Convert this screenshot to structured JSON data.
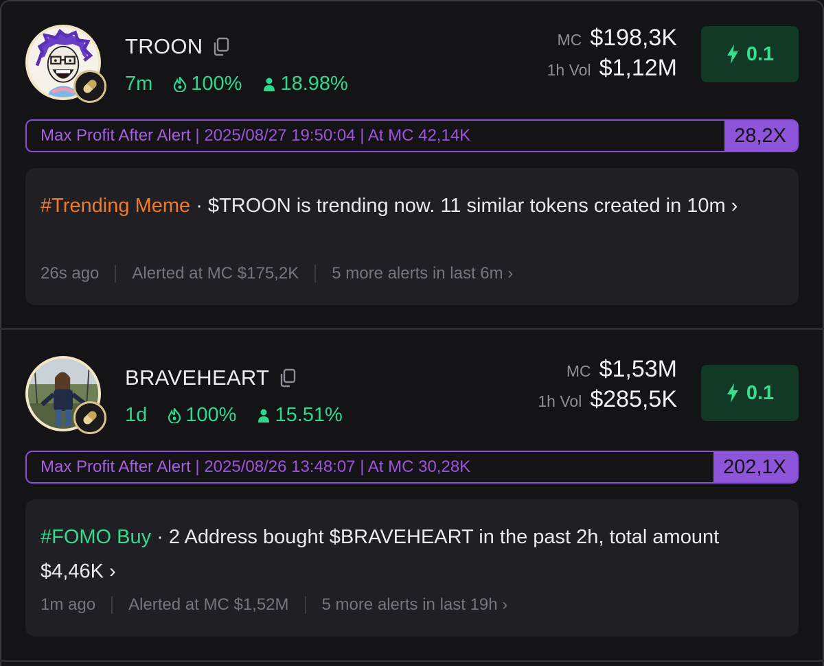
{
  "colors": {
    "background": "#141416",
    "accent_green": "#35e08f",
    "accent_purple": "#8e55db",
    "tag_orange": "#ef7a2a"
  },
  "cards": [
    {
      "name": "TROON",
      "age": "7m",
      "fire_pct": "100%",
      "holders_pct": "18.98%",
      "mc_label": "MC",
      "mc_value": "$198,3K",
      "vol_label": "1h Vol",
      "vol_value": "$1,12M",
      "buy_amount": "0.1",
      "profit_label": "Max Profit After Alert",
      "profit_info": "| 2025/08/27 19:50:04 | At MC 42,14K",
      "profit_mult": "28,2X",
      "tag": "#Trending Meme",
      "message": " · $TROON is trending now. 11 similar tokens created in 10m ›",
      "time_ago": "26s ago",
      "alerted_at": "Alerted at MC $175,2K",
      "more_alerts": "5 more alerts in last 6m ›"
    },
    {
      "name": "BRAVEHEART",
      "age": "1d",
      "fire_pct": "100%",
      "holders_pct": "15.51%",
      "mc_label": "MC",
      "mc_value": "$1,53M",
      "vol_label": "1h Vol",
      "vol_value": "$285,5K",
      "buy_amount": "0.1",
      "profit_label": "Max Profit After Alert",
      "profit_info": "| 2025/08/26 13:48:07 | At MC 30,28K",
      "profit_mult": "202,1X",
      "tag": "#FOMO Buy",
      "message": " · 2 Address bought $BRAVEHEART in the past 2h, total amount $4,46K ›",
      "time_ago": "1m ago",
      "alerted_at": "Alerted at MC $1,52M",
      "more_alerts": "5 more alerts in last 19h ›"
    }
  ]
}
